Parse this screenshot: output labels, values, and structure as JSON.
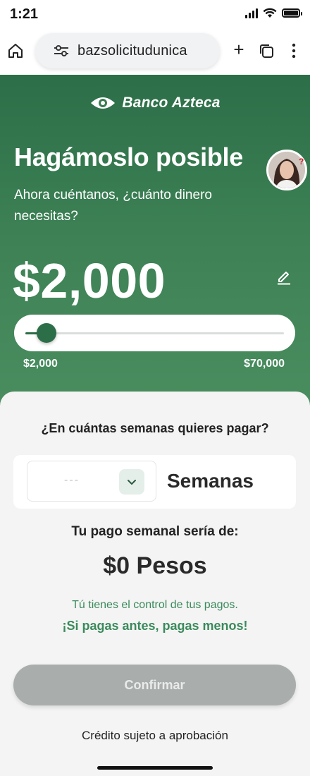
{
  "status_bar": {
    "time": "1:21"
  },
  "browser": {
    "url": "bazsolicitudunica",
    "icons": [
      "home-icon",
      "tune-icon",
      "plus-icon",
      "tabs-icon",
      "more-icon"
    ]
  },
  "hero": {
    "brand": "Banco Azteca",
    "title": "Hagámoslo posible",
    "subtitle": "Ahora cuéntanos, ¿cuánto dinero necesitas?",
    "amount": "$2,000",
    "slider": {
      "min_label": "$2,000",
      "max_label": "$70,000",
      "min": 2000,
      "max": 70000,
      "value": 2000
    }
  },
  "form": {
    "weeks_question": "¿En cuántas semanas quieres pagar?",
    "weeks_placeholder": "---",
    "weeks_label": "Semanas",
    "payment_title": "Tu pago semanal sería de:",
    "payment_amount": "$0 Pesos",
    "control_line1": "Tú tienes el control de tus pagos.",
    "control_line2": "¡Si pagas antes, pagas menos!",
    "confirm_label": "Confirmar",
    "disclaimer": "Crédito sujeto a aprobación"
  },
  "colors": {
    "brand_green": "#2c6e48",
    "accent_text_green": "#3b8a5c",
    "disabled_button": "#a9adab"
  }
}
